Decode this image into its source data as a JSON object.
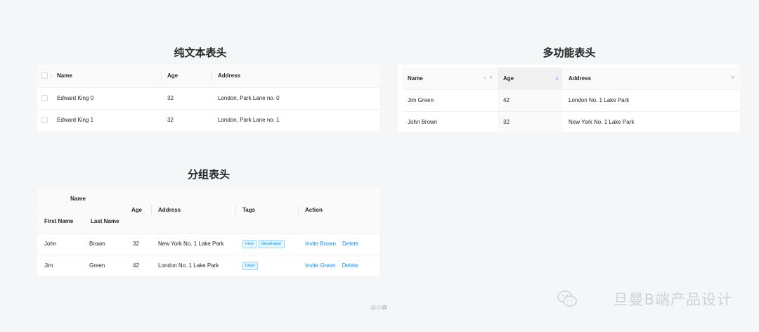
{
  "sections": {
    "plain": "纯文本表头",
    "multi": "多功能表头",
    "grouped": "分组表头"
  },
  "table1": {
    "headers": [
      "Name",
      "Age",
      "Address"
    ],
    "rows": [
      [
        "Edward King 0",
        "32",
        "London, Park Lane no. 0"
      ],
      [
        "Edward King 1",
        "32",
        "London, Park Lane no. 1"
      ]
    ]
  },
  "table2": {
    "headers": [
      "Name",
      "Age",
      "Address"
    ],
    "sorted_column": "Age",
    "rows": [
      [
        "Jim Green",
        "42",
        "London No. 1 Lake Park"
      ],
      [
        "John Brown",
        "32",
        "New York No. 1 Lake Park"
      ]
    ]
  },
  "table3": {
    "group_header": "Name",
    "sub_headers": [
      "First Name",
      "Last Name"
    ],
    "headers": [
      "Age",
      "Address",
      "Tags",
      "Action"
    ],
    "rows": [
      {
        "first": "John",
        "last": "Brown",
        "age": "32",
        "address": "New York No. 1 Lake Park",
        "tags": [
          "nice",
          "developer"
        ],
        "invite": "Invite Brown",
        "delete": "Delete"
      },
      {
        "first": "Jim",
        "last": "Green",
        "age": "42",
        "address": "London No. 1 Lake Park",
        "tags": [
          "loser"
        ],
        "invite": "Invite Green",
        "delete": "Delete"
      }
    ]
  },
  "footer": {
    "credit": "@小鹿",
    "watermark": "旦曼B端产品设计"
  },
  "colors": {
    "accent": "#1890ff",
    "header_bg": "#fafafa",
    "page_bg": "#f5f6f8"
  }
}
